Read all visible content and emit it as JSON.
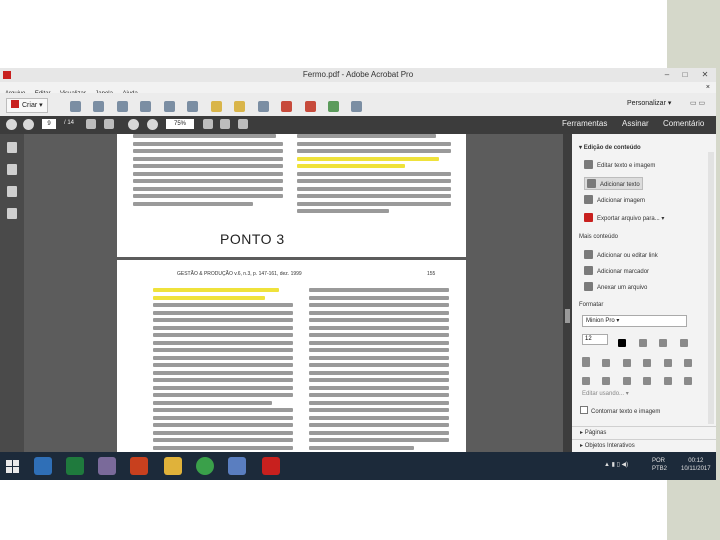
{
  "window": {
    "title": "Fermo.pdf - Adobe Acrobat Pro",
    "menu": [
      "Arquivo",
      "Editar",
      "Visualizar",
      "Janela",
      "Ajuda"
    ],
    "close_doc": "×"
  },
  "toolbar": {
    "create_label": "Criar",
    "personalize_label": "Personalizar"
  },
  "navigation": {
    "current_page": "9",
    "total_pages": "/ 14",
    "zoom": "75%"
  },
  "top_links": [
    "Ferramentas",
    "Assinar",
    "Comentário"
  ],
  "document": {
    "overlay_text": "PONTO 3",
    "page_header": "GESTÃO & PRODUÇÃO  v.6, n.3, p. 147-161, dez. 1999",
    "page_number": "155"
  },
  "right_panel": {
    "edit_section": "Edição de conteúdo",
    "edit_items": [
      "Editar texto e imagem",
      "Adicionar texto",
      "Adicionar imagem",
      "Exportar arquivo para..."
    ],
    "more_section": "Mais conteúdo",
    "more_items": [
      "Adicionar ou editar link",
      "Adicionar marcador",
      "Anexar um arquivo"
    ],
    "format_section": "Formatar",
    "font_value": "Minion Pro",
    "size_value": "12",
    "edit_using": "Editar usando...",
    "checkbox_label": "Contornar texto e imagem",
    "footer_items": [
      "Páginas",
      "Objetos Interativos"
    ]
  },
  "taskbar": {
    "language": "POR\nPTB2",
    "time": "00:12",
    "date": "10/11/2017"
  },
  "colors": {
    "acrobat_red": "#c8201e",
    "highlight": "#efe23b",
    "taskbar": "#1c2a3a"
  }
}
